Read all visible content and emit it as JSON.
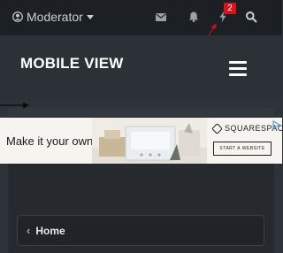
{
  "topbar": {
    "user_label": "Moderator",
    "icons": [
      "user-icon",
      "caret-down-icon",
      "envelope-icon",
      "bell-icon",
      "bolt-icon",
      "search-icon"
    ],
    "notification_count": "2"
  },
  "header": {
    "site_title": "MOBILE VIEW",
    "menu_icon": "hamburger-menu-icon"
  },
  "ad": {
    "tagline": "Make it your own.",
    "brand": "SQUARESPACE",
    "cta": "START A WEBSITE"
  },
  "breadcrumb": {
    "home_label": "Home"
  },
  "colors": {
    "topbar_bg": "#1c1f23",
    "header_bg": "#2c3137",
    "badge": "#d6141b",
    "annotation_arrow": "#c8101a",
    "breadcrumb_chevron": "#8fa8c6"
  }
}
